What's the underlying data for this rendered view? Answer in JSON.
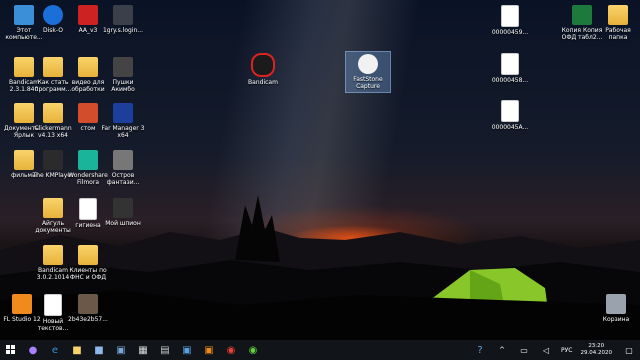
{
  "desktop": {
    "icons": [
      {
        "id": "etot",
        "label": "Этот компьюте...",
        "kind": "app",
        "color": "#3a8fd8"
      },
      {
        "id": "disko",
        "label": "Disk-O",
        "kind": "app",
        "color": "#1b6fd9"
      },
      {
        "id": "aa",
        "label": "AA_v3",
        "kind": "app",
        "color": "#c22"
      },
      {
        "id": "1gry",
        "label": "1gry.s.login...",
        "kind": "app",
        "color": "#3a3f4a"
      },
      {
        "id": "bandicam1",
        "label": "Bandicam 2.3.1.840",
        "kind": "folder",
        "color": "#e7b23a"
      },
      {
        "id": "kakstat",
        "label": "Как стать программ...",
        "kind": "folder",
        "color": "#e7b23a"
      },
      {
        "id": "video",
        "label": "видео для обработки",
        "kind": "folder",
        "color": "#e7b23a"
      },
      {
        "id": "pushki",
        "label": "Пушки Акимбо",
        "kind": "app",
        "color": "#444"
      },
      {
        "id": "docs",
        "label": "Документы - Ярлык",
        "kind": "folder",
        "color": "#e7b23a"
      },
      {
        "id": "clicker",
        "label": "Clickermann v4.13 x64",
        "kind": "folder",
        "color": "#e7b23a"
      },
      {
        "id": "stom",
        "label": "стом",
        "kind": "app",
        "color": "#d24d2c"
      },
      {
        "id": "farm",
        "label": "Far Manager 3 x64",
        "kind": "app",
        "color": "#1c3f9e"
      },
      {
        "id": "films",
        "label": "фильмы",
        "kind": "folder",
        "color": "#e7b23a"
      },
      {
        "id": "kmplayer",
        "label": "The KMPlayer",
        "kind": "app",
        "color": "#2b2b2b"
      },
      {
        "id": "filmora",
        "label": "Wondershare Filmora",
        "kind": "app",
        "color": "#19b49a"
      },
      {
        "id": "ostrov",
        "label": "Остров фантази...",
        "kind": "app",
        "color": "#777"
      },
      {
        "id": "aigul",
        "label": "Айгуль документы",
        "kind": "folder",
        "color": "#e7b23a"
      },
      {
        "id": "gigiena",
        "label": "гигиена",
        "kind": "doc",
        "color": "#fff"
      },
      {
        "id": "spy",
        "label": "Мой шпион",
        "kind": "app",
        "color": "#333"
      },
      {
        "id": "bandicam2",
        "label": "Bandicam 3.0.2.1014",
        "kind": "folder",
        "color": "#e7b23a"
      },
      {
        "id": "clients",
        "label": "Клиенты по ФНС и ОФД",
        "kind": "folder",
        "color": "#e7b23a"
      },
      {
        "id": "fl",
        "label": "FL Studio 12",
        "kind": "app",
        "color": "#f08a1c"
      },
      {
        "id": "newtxt",
        "label": "Новый текстов...",
        "kind": "doc",
        "color": "#fff"
      },
      {
        "id": "2b43",
        "label": "2b43e2b57...",
        "kind": "app",
        "color": "#6b5848"
      },
      {
        "id": "bandicam3",
        "label": "Bandicam",
        "kind": "app",
        "color": "#1b1b1b"
      },
      {
        "id": "faststone",
        "label": "FastStone Capture",
        "kind": "app",
        "color": "#f1f1f1"
      },
      {
        "id": "f1",
        "label": "00000459...",
        "kind": "doc",
        "color": "#fff"
      },
      {
        "id": "f2",
        "label": "00000458...",
        "kind": "doc",
        "color": "#fff"
      },
      {
        "id": "f3",
        "label": "0000045A...",
        "kind": "doc",
        "color": "#fff"
      },
      {
        "id": "kopia",
        "label": "Копия Копия ОФД табл2...",
        "kind": "app",
        "color": "#1e7a3c"
      },
      {
        "id": "rabochaya",
        "label": "Рабочая папка",
        "kind": "folder",
        "color": "#e7b23a"
      },
      {
        "id": "korzina",
        "label": "Корзина",
        "kind": "app",
        "color": "#9aa3ad"
      }
    ]
  },
  "taskbar": {
    "language": "РУС",
    "time": "23:20",
    "date": "29.04.2020"
  }
}
